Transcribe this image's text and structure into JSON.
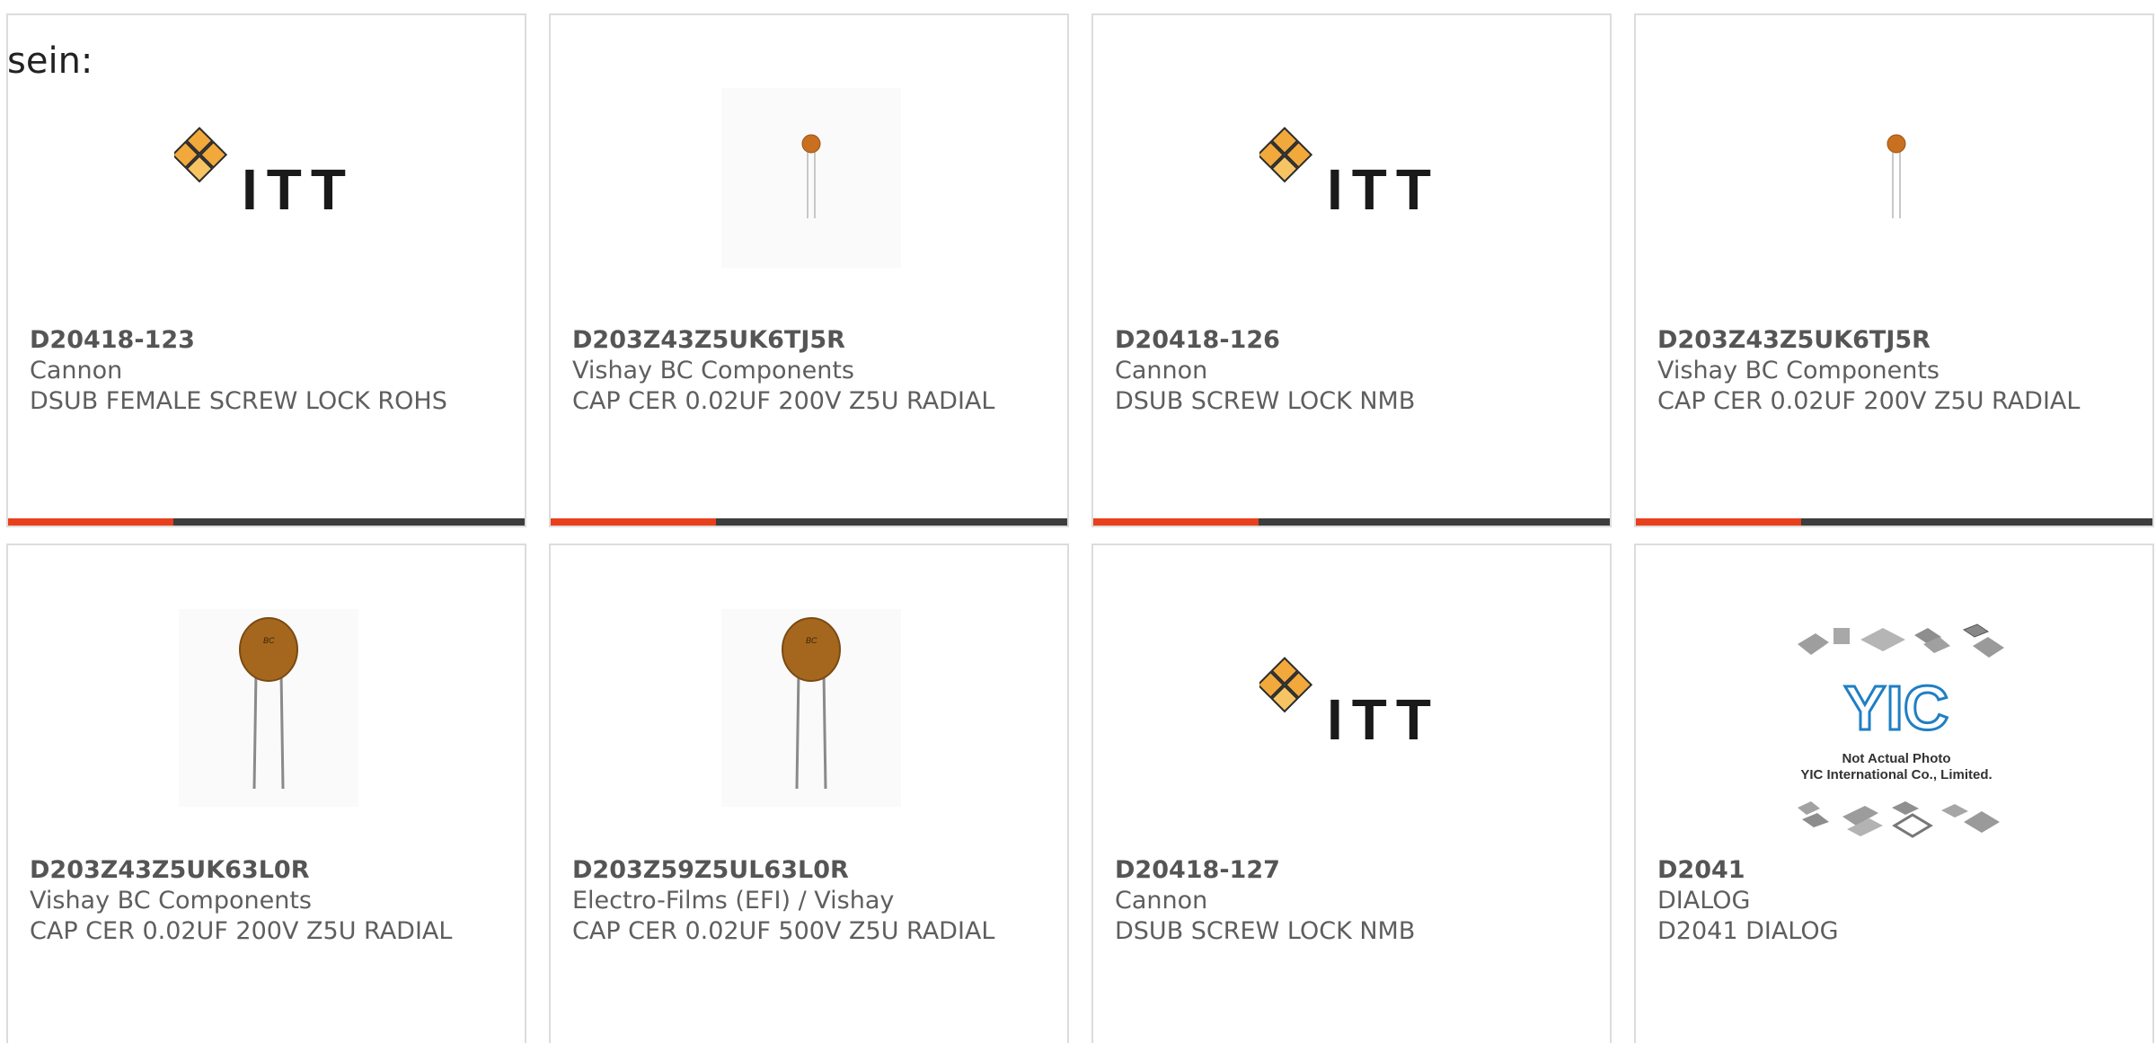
{
  "intro_text": "sein:",
  "colors": {
    "accent": "#e8401c",
    "bar_rest": "#3d3d3d",
    "card_border": "#dcdcdc",
    "itt_orange": "#f2a93b",
    "capacitor_body": "#a5671e",
    "yic_blue": "#1f7fc4"
  },
  "products": [
    {
      "part_number": "D20418-123",
      "manufacturer": "Cannon",
      "description": "DSUB FEMALE SCREW LOCK ROHS",
      "image": "itt-logo"
    },
    {
      "part_number": "D203Z43Z5UK6TJ5R",
      "manufacturer": "Vishay BC Components",
      "description": "CAP CER 0.02UF 200V Z5U RADIAL",
      "image": "small-capacitor"
    },
    {
      "part_number": "D20418-126",
      "manufacturer": "Cannon",
      "description": "DSUB SCREW LOCK NMB",
      "image": "itt-logo"
    },
    {
      "part_number": "D203Z43Z5UK6TJ5R",
      "manufacturer": "Vishay BC Components",
      "description": "CAP CER 0.02UF 200V Z5U RADIAL",
      "image": "small-capacitor"
    },
    {
      "part_number": "D203Z43Z5UK63L0R",
      "manufacturer": "Vishay BC Components",
      "description": "CAP CER 0.02UF 200V Z5U RADIAL",
      "image": "large-capacitor"
    },
    {
      "part_number": "D203Z59Z5UL63L0R",
      "manufacturer": "Electro-Films (EFI) / Vishay",
      "description": "CAP CER 0.02UF 500V Z5U RADIAL",
      "image": "large-capacitor"
    },
    {
      "part_number": "D20418-127",
      "manufacturer": "Cannon",
      "description": "DSUB SCREW LOCK NMB",
      "image": "itt-logo"
    },
    {
      "part_number": "D2041",
      "manufacturer": "DIALOG",
      "description": "D2041 DIALOG",
      "image": "yic-placeholder",
      "image_text": {
        "logo": "YIC",
        "line1": "Not Actual Photo",
        "line2": "YIC International Co., Limited."
      }
    }
  ],
  "itt_logo_text": "ITT"
}
